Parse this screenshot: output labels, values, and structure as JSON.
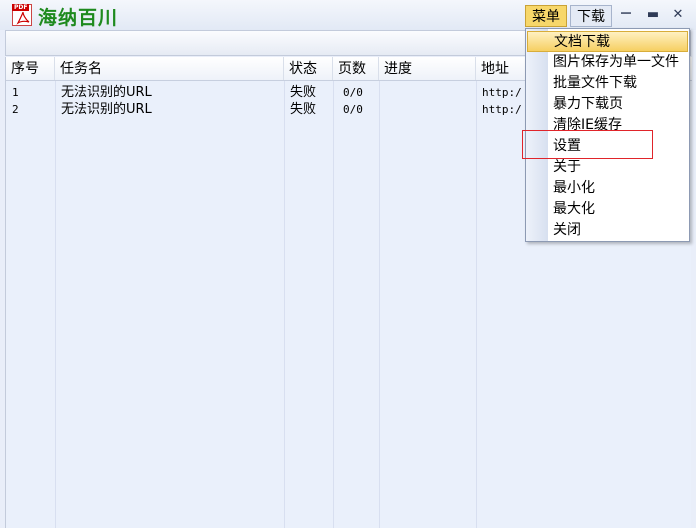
{
  "app": {
    "title": "海纳百川",
    "icon_badge": "PDF",
    "menu_button": "菜单",
    "download_button": "下载"
  },
  "window_controls": {
    "minimize": "－",
    "maximize": "▬",
    "close": "✕"
  },
  "table": {
    "columns": [
      "序号",
      "任务名",
      "状态",
      "页数",
      "进度",
      "地址"
    ],
    "rows": [
      {
        "index": "1",
        "name": "无法识别的URL",
        "status": "失败",
        "pages": "0/0",
        "progress": "",
        "url": "http:/"
      },
      {
        "index": "2",
        "name": "无法识别的URL",
        "status": "失败",
        "pages": "0/0",
        "progress": "",
        "url": "http:/"
      }
    ]
  },
  "dropdown_menu": {
    "items": [
      "文档下载",
      "图片保存为单一文件",
      "批量文件下载",
      "暴力下载页",
      "清除IE缓存",
      "设置",
      "关于",
      "最小化",
      "最大化",
      "关闭"
    ],
    "highlighted_index": 0,
    "annotated_index": 5
  },
  "colors": {
    "title_green": "#1e8a1e",
    "menu_button_bg": "#f7d76a",
    "list_bg": "#eaf0fb",
    "annotation_red": "#e0242a"
  }
}
